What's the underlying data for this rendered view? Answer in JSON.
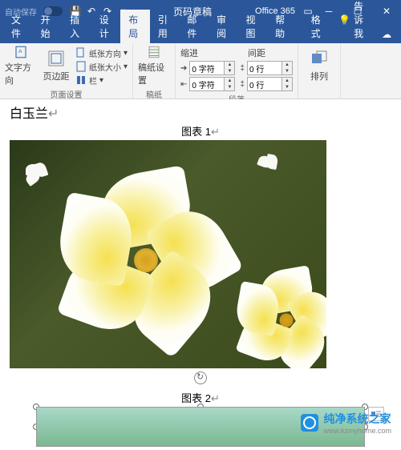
{
  "titlebar": {
    "autosave": "自动保存",
    "title": "页码章稿",
    "office": "Office 365"
  },
  "menu": {
    "file": "文件",
    "home": "开始",
    "insert": "插入",
    "design": "设计",
    "layout": "布局",
    "references": "引用",
    "mailings": "邮件",
    "review": "审阅",
    "view": "视图",
    "help": "帮助",
    "format": "格式",
    "tellme": "告诉我"
  },
  "ribbon": {
    "text_direction": "文字方向",
    "margins": "页边距",
    "orientation": "纸张方向",
    "size": "纸张大小",
    "columns": "栏",
    "page_setup_label": "页面设置",
    "gaozhi_settings": "稿纸设置",
    "gaozhi_label": "稿纸",
    "indent": "缩进",
    "spacing": "间距",
    "indent_left_val": "0 字符",
    "indent_right_val": "0 字符",
    "spacing_before_val": "0 行",
    "spacing_after_val": "0 行",
    "paragraph_label": "段落",
    "arrange": "排列"
  },
  "document": {
    "title_text": "白玉兰",
    "caption1": "图表 1",
    "caption2": "图表 2",
    "return_char": "↵"
  },
  "watermark": {
    "brand": "纯净系统之家",
    "url": "www.kzmyhome.com"
  }
}
